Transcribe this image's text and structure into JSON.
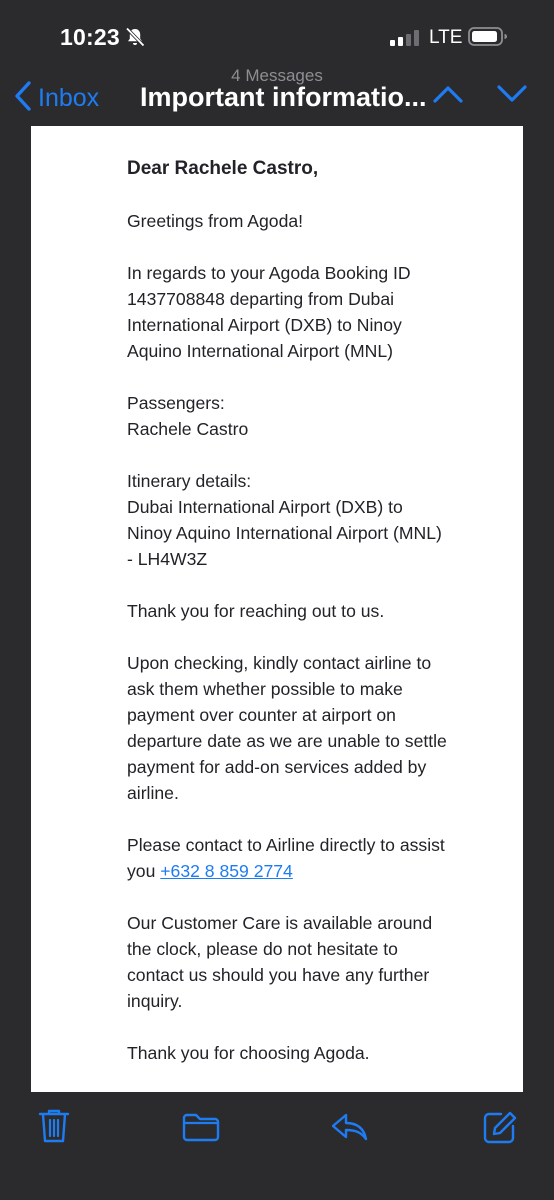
{
  "status": {
    "time": "10:23",
    "network": "LTE"
  },
  "nav": {
    "back_label": "Inbox",
    "message_count": "4 Messages",
    "subject": "Important informatio..."
  },
  "email": {
    "greeting": "Dear Rachele Castro,",
    "paragraphs": [
      "Greetings from Agoda!",
      "In regards to your Agoda Booking ID 1437708848 departing from Dubai International Airport (DXB) to Ninoy Aquino International Airport (MNL)",
      "Passengers:\nRachele Castro",
      "Itinerary details:\nDubai International Airport (DXB) to Ninoy Aquino International Airport (MNL) - LH4W3Z",
      "Thank you for reaching out to us.",
      "Upon checking, kindly contact airline to ask them whether possible to make payment over counter at airport on departure date as we are unable to settle payment for add-on services added by airline."
    ],
    "contact_text": "Please contact to Airline directly to assist you ",
    "phone": "+632 8 859 2774",
    "closing_paragraphs": [
      "Our Customer Care is available around the clock, please do not hesitate to contact us should you have any further inquiry.",
      "Thank you for choosing Agoda."
    ]
  },
  "colors": {
    "accent": "#1e7cf2",
    "chrome": "#2b2b2d"
  },
  "toolbar_icons": [
    "trash-icon",
    "folder-icon",
    "reply-icon",
    "compose-icon"
  ]
}
